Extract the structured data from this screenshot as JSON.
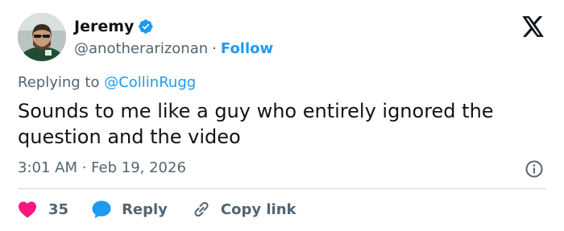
{
  "author": {
    "display_name": "Jeremy",
    "handle": "@anotherarizonan",
    "separator": "·",
    "follow_label": "Follow",
    "verified": true
  },
  "reply_context": {
    "prefix": "Replying to",
    "mention": "@CollinRugg"
  },
  "tweet": {
    "text": "Sounds to me like a guy who entirely ignored the question and the video",
    "timestamp": "3:01 AM · Feb 19, 2026"
  },
  "actions": {
    "like_count": "35",
    "reply_label": "Reply",
    "copy_link_label": "Copy link"
  },
  "colors": {
    "text": "#0f1419",
    "secondary": "#536471",
    "accent": "#1d9bf0",
    "like": "#f91880",
    "divider": "#cfd9de"
  },
  "icons": [
    "verified-badge-icon",
    "x-logo-icon",
    "info-icon",
    "heart-icon",
    "reply-bubble-icon",
    "link-icon"
  ]
}
